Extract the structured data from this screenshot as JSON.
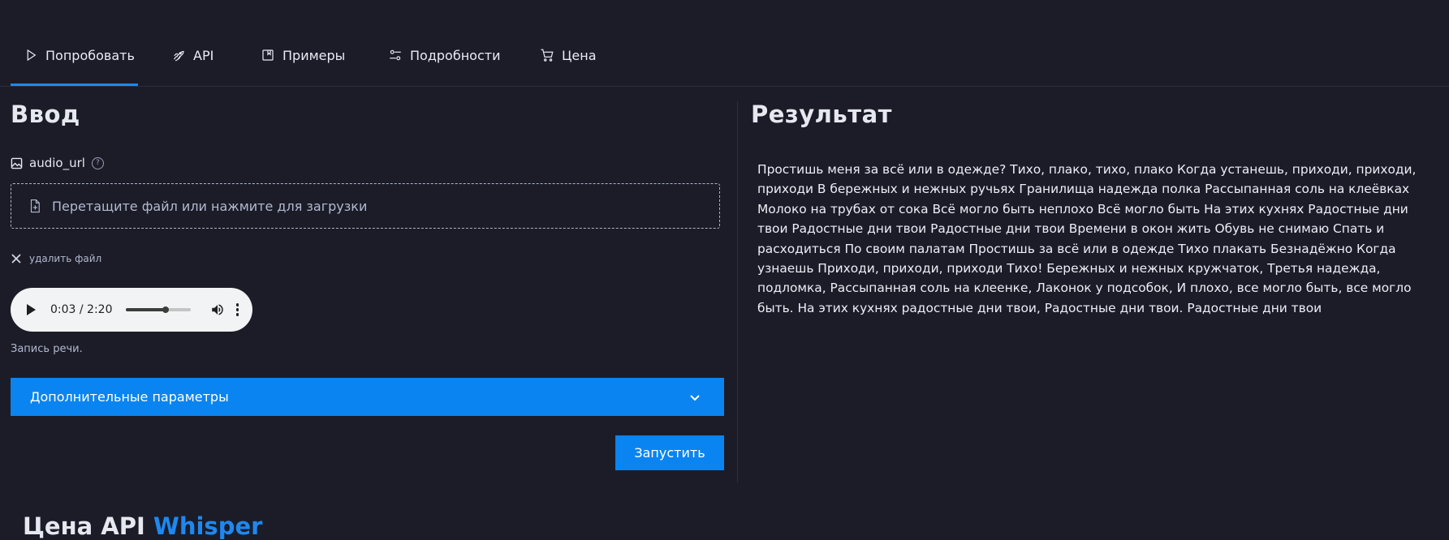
{
  "tabs": [
    {
      "label": "Попробовать",
      "icon": "play-icon",
      "active": true
    },
    {
      "label": "API",
      "icon": "rocket-icon"
    },
    {
      "label": "Примеры",
      "icon": "bookmark-icon"
    },
    {
      "label": "Подробности",
      "icon": "sliders-icon"
    },
    {
      "label": "Цена",
      "icon": "cart-icon"
    }
  ],
  "input": {
    "heading": "Ввод",
    "field_label": "audio_url",
    "help_glyph": "?",
    "dropzone_text": "Перетащите файл или нажмите для загрузки",
    "remove_label": "удалить файл",
    "audio": {
      "time": "0:03 / 2:20",
      "progress": 0.62
    },
    "caption": "Запись речи.",
    "advanced_label": "Дополнительные параметры",
    "run_label": "Запустить"
  },
  "result": {
    "heading": "Результат",
    "text": "Простишь меня за всё или в одежде? Тихо, плако, тихо, плако Когда устанешь, приходи, приходи, приходи В бережных и нежных ручьях Гранилища надежда полка Рассыпанная соль на клеёвках Молоко на трубах от сока Всё могло быть неплохо Всё могло быть На этих кухнях Радостные дни твои Радостные дни твои Радостные дни твои Времени в окон жить Обувь не снимаю Спать и расходиться По своим палатам Простишь за всё или в одежде Тихо плакать Безнадёжно Когда узнаешь Приходи, приходи, приходи Тихо! Бережных и нежных кружчаток, Третья надежда, подломка, Рассыпанная соль на клеенке, Лаконок у подсобок, И плохо, все могло быть, все могло быть. На этих кухнях радостные дни твои, Радостные дни твои. Радостные дни твои"
  },
  "footer": {
    "title_part1": "Цена API ",
    "title_part2": "Whisper"
  },
  "colors": {
    "accent": "#0a84f0",
    "background": "#1b1c28"
  }
}
